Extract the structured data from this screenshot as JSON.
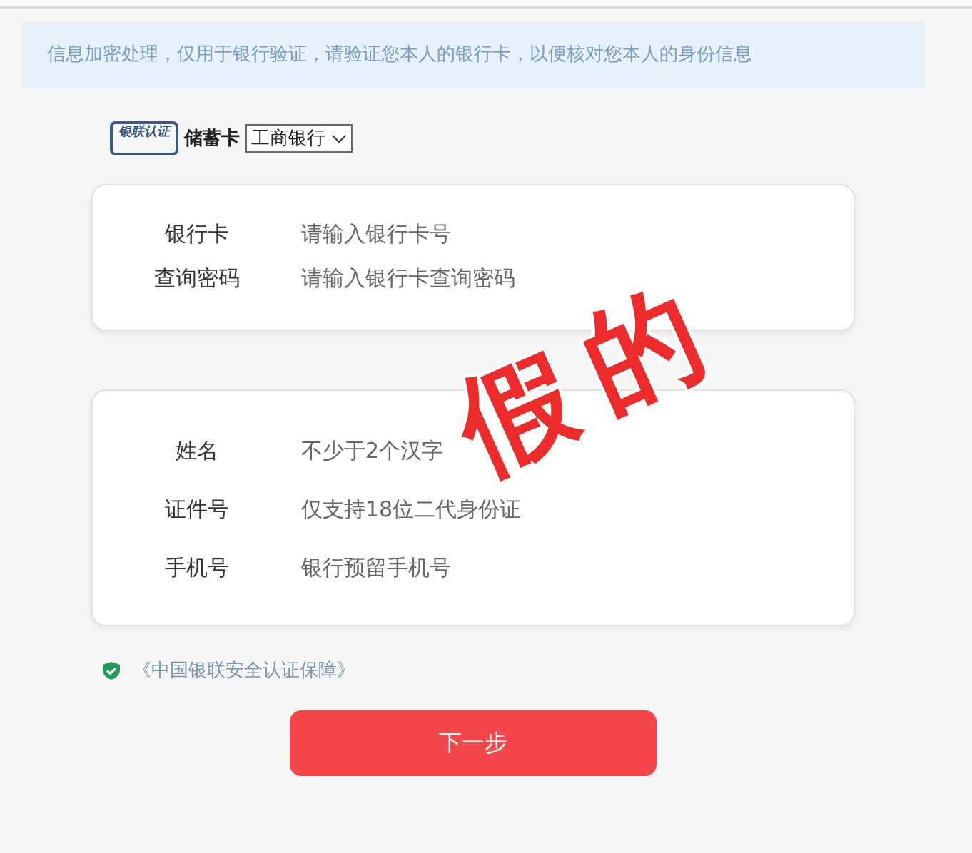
{
  "notice": "信息加密处理，仅用于银行验证，请验证您本人的银行卡，以便核对您本人的身份信息",
  "card_type": {
    "logo": "银联认证",
    "label": "储蓄卡",
    "bank_select": "工商银行"
  },
  "sections": [
    {
      "fields": [
        {
          "label": "银行卡",
          "placeholder": "请输入银行卡号"
        },
        {
          "label": "查询密码",
          "placeholder": "请输入银行卡查询密码"
        }
      ]
    },
    {
      "fields": [
        {
          "label": "姓名",
          "placeholder": "不少于2个汉字"
        },
        {
          "label": "证件号",
          "placeholder": "仅支持18位二代身份证"
        },
        {
          "label": "手机号",
          "placeholder": "银行预留手机号"
        }
      ]
    }
  ],
  "security_link": "《中国银联安全认证保障》",
  "next_button": "下一步",
  "stamp": "假的"
}
